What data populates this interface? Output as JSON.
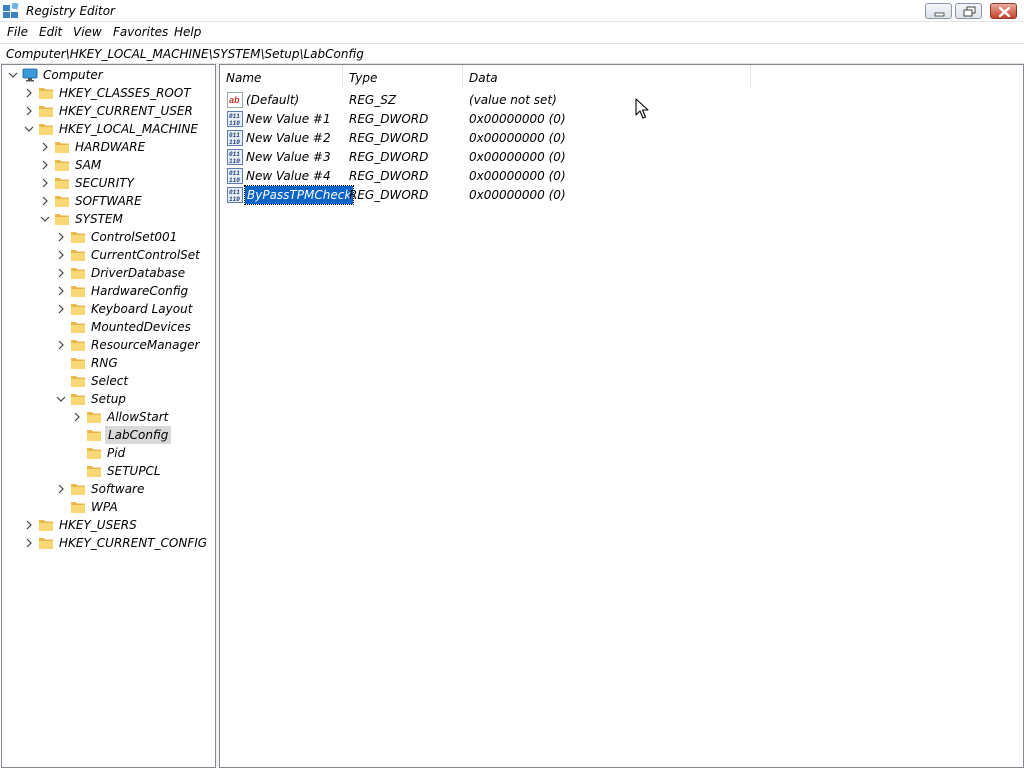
{
  "window": {
    "title": "Registry Editor",
    "icon": "registry-icon"
  },
  "menu": [
    "File",
    "Edit",
    "View",
    "Favorites",
    "Help"
  ],
  "address": "Computer\\HKEY_LOCAL_MACHINE\\SYSTEM\\Setup\\LabConfig",
  "tree": [
    {
      "label": "Computer",
      "level": 0,
      "state": "expanded",
      "icon": "computer-icon"
    },
    {
      "label": "HKEY_CLASSES_ROOT",
      "level": 1,
      "state": "collapsed",
      "icon": "folder-icon"
    },
    {
      "label": "HKEY_CURRENT_USER",
      "level": 1,
      "state": "collapsed",
      "icon": "folder-icon"
    },
    {
      "label": "HKEY_LOCAL_MACHINE",
      "level": 1,
      "state": "expanded",
      "icon": "folder-icon"
    },
    {
      "label": "HARDWARE",
      "level": 2,
      "state": "collapsed",
      "icon": "folder-icon"
    },
    {
      "label": "SAM",
      "level": 2,
      "state": "collapsed",
      "icon": "folder-icon"
    },
    {
      "label": "SECURITY",
      "level": 2,
      "state": "collapsed",
      "icon": "folder-icon"
    },
    {
      "label": "SOFTWARE",
      "level": 2,
      "state": "collapsed",
      "icon": "folder-icon"
    },
    {
      "label": "SYSTEM",
      "level": 2,
      "state": "expanded",
      "icon": "folder-icon"
    },
    {
      "label": "ControlSet001",
      "level": 3,
      "state": "collapsed",
      "icon": "folder-icon"
    },
    {
      "label": "CurrentControlSet",
      "level": 3,
      "state": "collapsed",
      "icon": "folder-icon"
    },
    {
      "label": "DriverDatabase",
      "level": 3,
      "state": "collapsed",
      "icon": "folder-icon"
    },
    {
      "label": "HardwareConfig",
      "level": 3,
      "state": "collapsed",
      "icon": "folder-icon"
    },
    {
      "label": "Keyboard Layout",
      "level": 3,
      "state": "collapsed",
      "icon": "folder-icon"
    },
    {
      "label": "MountedDevices",
      "level": 3,
      "state": "leaf",
      "icon": "folder-icon"
    },
    {
      "label": "ResourceManager",
      "level": 3,
      "state": "collapsed",
      "icon": "folder-icon"
    },
    {
      "label": "RNG",
      "level": 3,
      "state": "leaf",
      "icon": "folder-icon"
    },
    {
      "label": "Select",
      "level": 3,
      "state": "leaf",
      "icon": "folder-icon"
    },
    {
      "label": "Setup",
      "level": 3,
      "state": "expanded",
      "icon": "folder-icon"
    },
    {
      "label": "AllowStart",
      "level": 4,
      "state": "collapsed",
      "icon": "folder-icon"
    },
    {
      "label": "LabConfig",
      "level": 4,
      "state": "leaf",
      "icon": "folder-icon",
      "selected": true
    },
    {
      "label": "Pid",
      "level": 4,
      "state": "leaf",
      "icon": "folder-icon"
    },
    {
      "label": "SETUPCL",
      "level": 4,
      "state": "leaf",
      "icon": "folder-icon"
    },
    {
      "label": "Software",
      "level": 3,
      "state": "collapsed",
      "icon": "folder-icon"
    },
    {
      "label": "WPA",
      "level": 3,
      "state": "leaf",
      "icon": "folder-icon"
    },
    {
      "label": "HKEY_USERS",
      "level": 1,
      "state": "collapsed",
      "icon": "folder-icon"
    },
    {
      "label": "HKEY_CURRENT_CONFIG",
      "level": 1,
      "state": "collapsed",
      "icon": "folder-icon"
    }
  ],
  "columns": {
    "name": "Name",
    "type": "Type",
    "data": "Data"
  },
  "values": [
    {
      "name": "(Default)",
      "type": "REG_SZ",
      "data": "(value not set)",
      "icon": "string-value-icon"
    },
    {
      "name": "New Value #1",
      "type": "REG_DWORD",
      "data": "0x00000000 (0)",
      "icon": "binary-value-icon"
    },
    {
      "name": "New Value #2",
      "type": "REG_DWORD",
      "data": "0x00000000 (0)",
      "icon": "binary-value-icon"
    },
    {
      "name": "New Value #3",
      "type": "REG_DWORD",
      "data": "0x00000000 (0)",
      "icon": "binary-value-icon"
    },
    {
      "name": "New Value #4",
      "type": "REG_DWORD",
      "data": "0x00000000 (0)",
      "icon": "binary-value-icon"
    },
    {
      "name": "ByPassTPMCheck",
      "type": "REG_DWORD",
      "data": "0x00000000 (0)",
      "icon": "binary-value-icon",
      "selected": true,
      "editing": true
    }
  ],
  "colors": {
    "selection": "#0a64c8",
    "tree_selection": "#d9d9d9",
    "folder": "#f8d775",
    "folder_dark": "#e8b84a",
    "computer": "#3a9ad9"
  }
}
